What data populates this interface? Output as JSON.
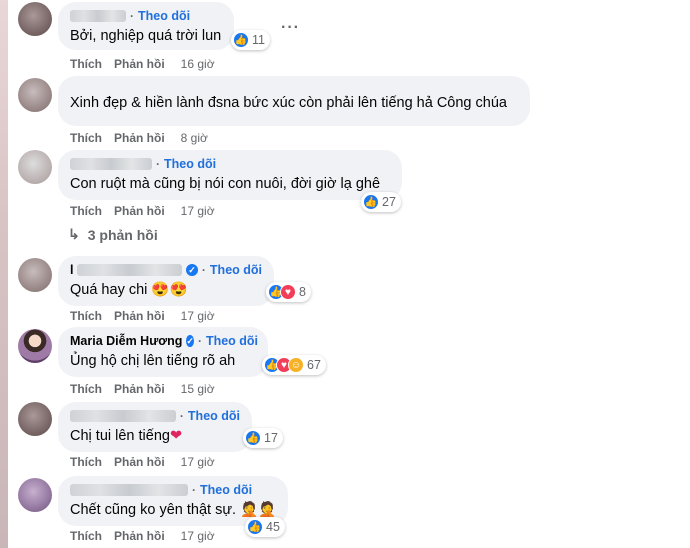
{
  "follow_label": "Theo dõi",
  "like_label": "Thích",
  "reply_label": "Phản hồi",
  "more_label": "···",
  "comments": [
    {
      "text": "Bởi, nghiệp quá trời lun",
      "time": "16 giờ",
      "reactions": "11"
    },
    {
      "text": "Xinh đẹp & hiền lành đsna bức xúc còn phải lên tiếng hả Công chúa",
      "time": "8 giờ"
    },
    {
      "text": "Con ruột mà cũng bị nói con nuôi, đời giờ lạ ghê",
      "time": "17 giờ",
      "reactions": "27"
    },
    {
      "name_initial": "l",
      "text": "Quá hay chi",
      "text_emoji": "😍😍",
      "time": "17 giờ",
      "reactions": "8"
    },
    {
      "name": "Maria Diễm Hương",
      "text": "Ủng hộ chị lên tiếng rõ ah",
      "time": "15 giờ",
      "reactions": "67"
    },
    {
      "text": "Chị tui lên tiếng",
      "text_emoji": "❤",
      "time": "17 giờ",
      "reactions": "17"
    },
    {
      "text": "Chết cũng ko yên thật sự.",
      "text_emoji": "🤦🤦",
      "time": "17 giờ",
      "reactions": "45"
    }
  ],
  "replies_label": "3 phản hồi",
  "icons": {
    "like": "thumbs-up-icon",
    "love": "heart-icon",
    "care": "care-icon",
    "reply_arrow": "reply-arrow-icon",
    "verified": "verified-badge-icon"
  },
  "colors": {
    "follow": "#216fdb",
    "bubble": "#f0f2f5",
    "meta": "#65676b",
    "like": "#1877f2",
    "love": "#f33e58"
  }
}
